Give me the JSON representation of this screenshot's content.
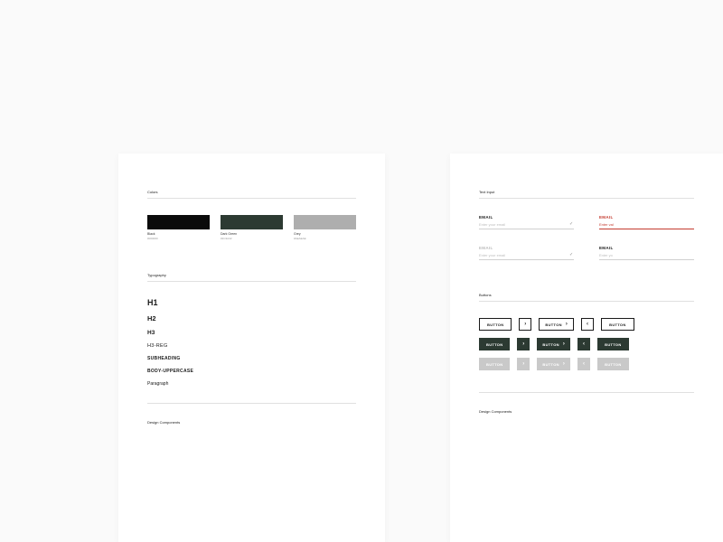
{
  "left": {
    "section_colors": "Colors",
    "swatches": [
      {
        "name": "Black",
        "hex": "#000000"
      },
      {
        "name": "Dark Green",
        "hex": "#2C3A32"
      },
      {
        "name": "Grey",
        "hex": "#AEAEAE"
      }
    ],
    "section_typo": "Typography",
    "typo": {
      "h1": "H1",
      "h2": "H2",
      "h3": "H3",
      "h3reg": "H3-REG",
      "sub": "SUBHEADING",
      "bodyU": "BODY-UPPERCASE",
      "para": "Paragraph"
    },
    "footer": "Design Components"
  },
  "right": {
    "section_inputs": "Text Input",
    "fields": {
      "a_label": "EMAIL",
      "a_ph": "Enter your email",
      "b_label": "EMAIL",
      "b_ph": "Enter val",
      "c_label": "EMAIL",
      "c_ph": "Enter your email",
      "d_label": "EMAIL",
      "d_ph": "Enter yo"
    },
    "section_buttons": "Buttons",
    "btn_label": "BUTTON",
    "footer": "Design Components"
  }
}
